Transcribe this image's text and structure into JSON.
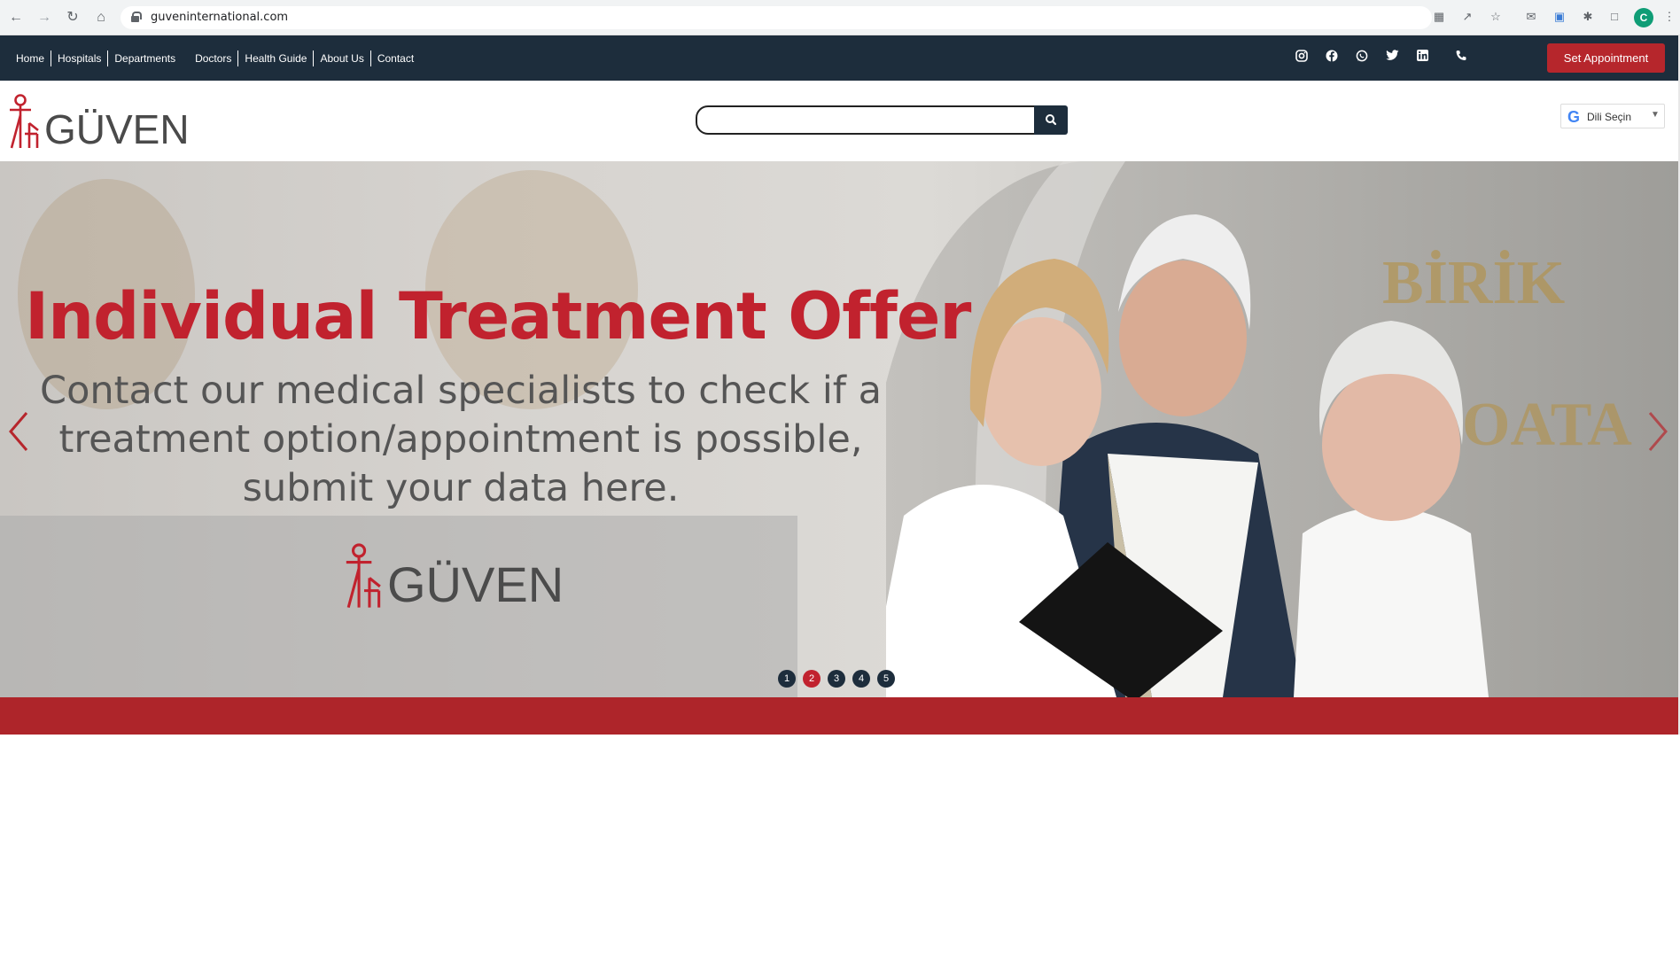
{
  "browser": {
    "url": "guveninternational.com",
    "profile_initial": "C",
    "icons": [
      "back-icon",
      "forward-icon",
      "reload-icon",
      "home-icon",
      "lock-icon",
      "translate-icon",
      "share-icon",
      "bookmark-star-icon",
      "extension-icon",
      "puzzle-icon",
      "sidebar-icon",
      "menu-icon"
    ]
  },
  "nav": {
    "links": [
      "Home",
      "Hospitals",
      "Departments",
      "Doctors",
      "Health Guide",
      "About Us",
      "Contact"
    ],
    "social_icons": [
      "instagram-icon",
      "facebook-icon",
      "whatsapp-icon",
      "twitter-icon",
      "linkedin-icon",
      "phone-icon"
    ],
    "appointment_label": "Set Appointment"
  },
  "header": {
    "logo_text": "GÜVEN",
    "search_placeholder": "",
    "language_label": "Dili Seçin"
  },
  "hero": {
    "title": "Individual Treatment Offer",
    "subtitle": "Contact our medical specialists to check if a treatment option/appointment is possible, submit your data here.",
    "logo_text": "GÜVEN",
    "slides": [
      "1",
      "2",
      "3",
      "4",
      "5"
    ],
    "active_slide": 2
  },
  "colors": {
    "brand_red": "#c1222e",
    "navy": "#1d2d3c",
    "band_red": "#ae252a"
  }
}
